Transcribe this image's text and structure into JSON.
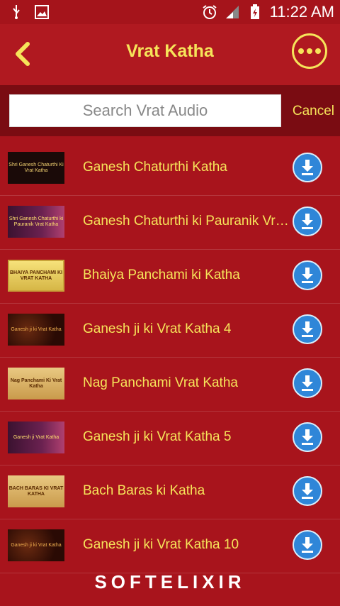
{
  "status_bar": {
    "time": "11:22 AM"
  },
  "header": {
    "title": "Vrat Katha"
  },
  "search": {
    "placeholder": "Search Vrat Audio",
    "cancel_label": "Cancel"
  },
  "items": [
    {
      "label": "Ganesh Chaturthi Katha",
      "thumb": "Shri Ganesh Chaturthi Ki Vrat Katha"
    },
    {
      "label": "Ganesh Chaturthi ki Pauranik Vrat Katha",
      "thumb": "Shri Ganesh Chaturthi ki Pauranik Vrat Katha"
    },
    {
      "label": "Bhaiya Panchami ki Katha",
      "thumb": "BHAIYA PANCHAMI KI VRAT KATHA"
    },
    {
      "label": "Ganesh ji ki Vrat Katha 4",
      "thumb": "Ganesh ji ki Vrat Katha"
    },
    {
      "label": "Nag Panchami Vrat Katha",
      "thumb": "Nag Panchami Ki Vrat Katha"
    },
    {
      "label": "Ganesh ji ki Vrat Katha 5",
      "thumb": "Ganesh ji Vrat Katha"
    },
    {
      "label": "Bach Baras ki Katha",
      "thumb": "BACH BARAS KI VRAT KATHA"
    },
    {
      "label": "Ganesh ji ki Vrat Katha 10",
      "thumb": "Ganesh ji ki Vrat Katha"
    }
  ],
  "brand": {
    "name": "SOFTELIXIR"
  },
  "colors": {
    "background": "#a8141c",
    "accent": "#f6e45a",
    "download": "#2f86d8"
  }
}
